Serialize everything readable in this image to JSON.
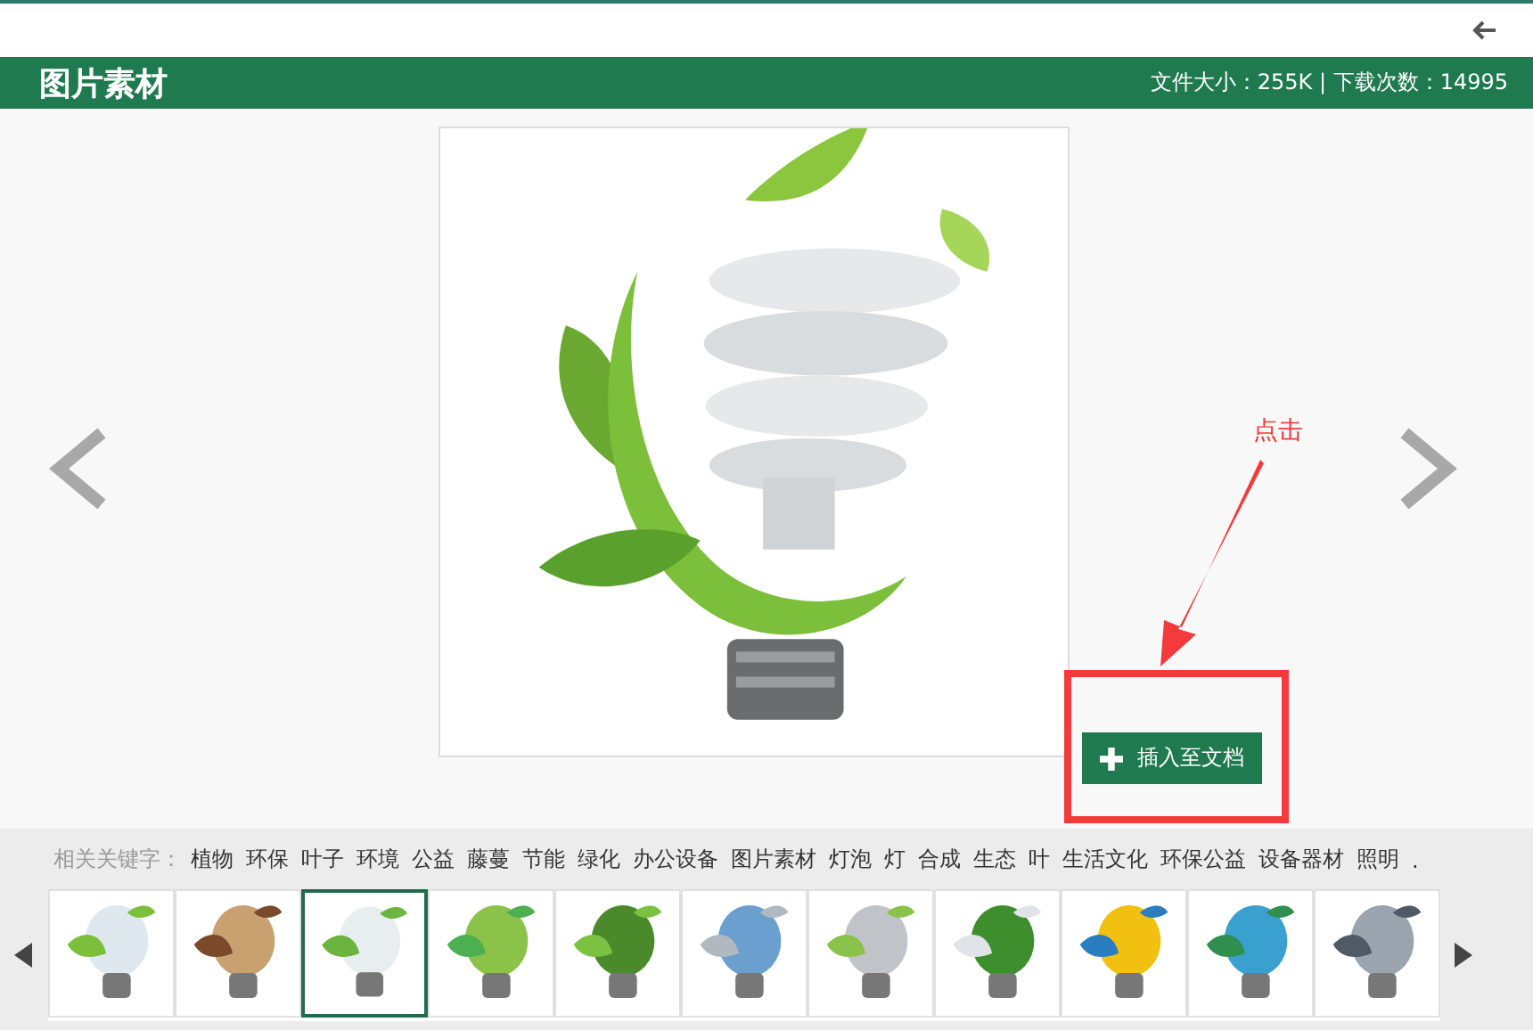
{
  "header": {
    "title": "图片素材",
    "info": "文件大小：255K | 下载次数：14995"
  },
  "annotation": {
    "label": "点击"
  },
  "insert_button": {
    "label": "插入至文档"
  },
  "keywords": {
    "label": "相关关键字：",
    "items": [
      "植物",
      "环保",
      "叶子",
      "环境",
      "公益",
      "藤蔓",
      "节能",
      "绿化",
      "办公设备",
      "图片素材",
      "灯泡",
      "灯",
      "合成",
      "生态",
      "叶",
      "生活文化",
      "环保公益",
      "设备器材",
      "照明",
      "."
    ]
  },
  "thumbnails": [
    {
      "selected": false
    },
    {
      "selected": false
    },
    {
      "selected": true
    },
    {
      "selected": false
    },
    {
      "selected": false
    },
    {
      "selected": false
    },
    {
      "selected": false
    },
    {
      "selected": false
    },
    {
      "selected": false
    },
    {
      "selected": false
    },
    {
      "selected": false
    }
  ]
}
